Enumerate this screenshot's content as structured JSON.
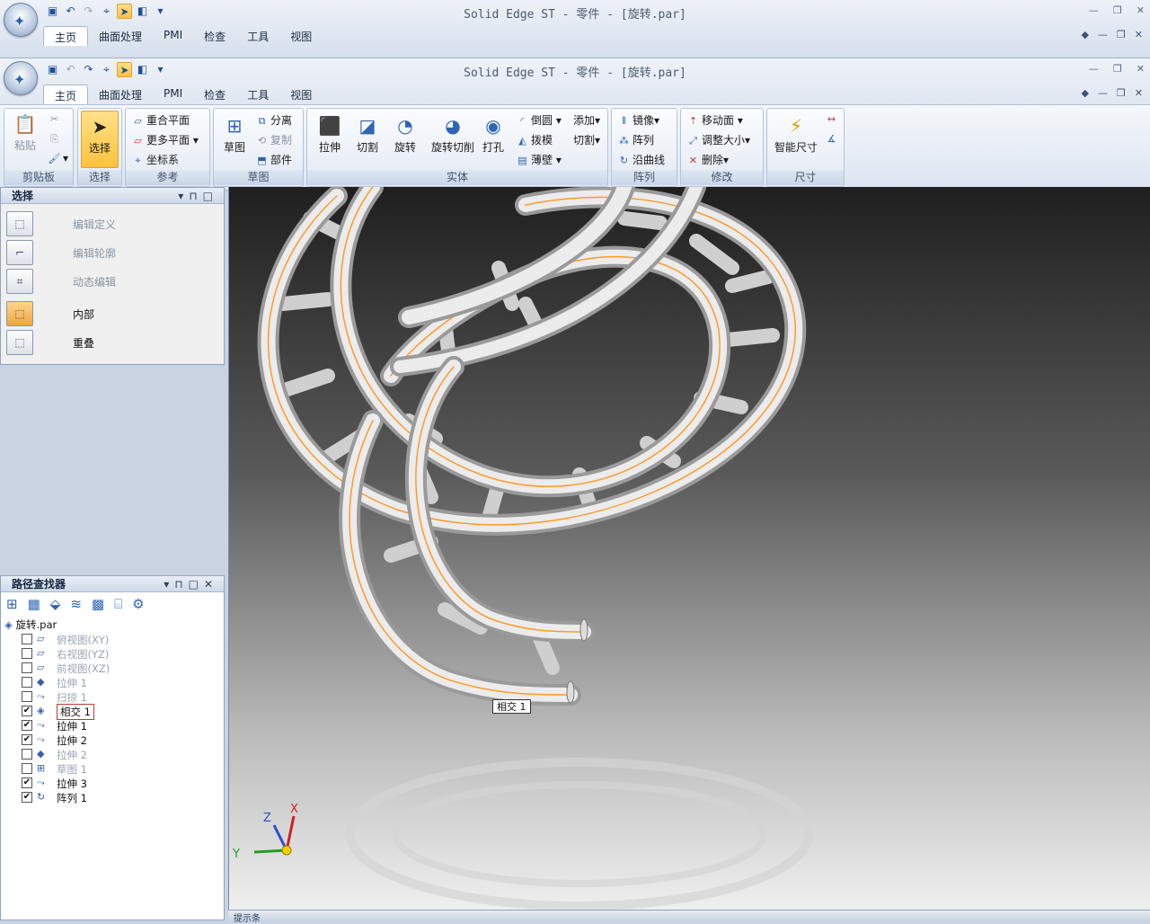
{
  "back_window": {
    "title": "Solid Edge ST - 零件 - [旋转.par]",
    "tabs": [
      "主页",
      "曲面处理",
      "PMI",
      "检查",
      "工具",
      "视图"
    ]
  },
  "window": {
    "title": "Solid Edge ST - 零件 - [旋转.par]",
    "tabs": [
      "主页",
      "曲面处理",
      "PMI",
      "检查",
      "工具",
      "视图"
    ],
    "active_tab": "主页"
  },
  "ribbon": {
    "clipboard": {
      "label": "剪贴板",
      "paste": "粘贴"
    },
    "select": {
      "label": "选择",
      "select": "选择"
    },
    "reference": {
      "label": "参考",
      "coincident_plane": "重合平面",
      "more_planes": "更多平面",
      "coordinate_system": "坐标系"
    },
    "sketch": {
      "label": "草图",
      "sketch": "草图",
      "separate": "分离",
      "copy": "复制",
      "part": "部件"
    },
    "solid": {
      "label": "实体",
      "extrude": "拉伸",
      "cut": "切割",
      "revolve": "旋转",
      "revolve_cut": "旋转切削",
      "hole": "打孔",
      "round": "倒圆",
      "draft": "拨模",
      "thin_wall": "薄壁",
      "add": "添加",
      "cut2": "切割"
    },
    "pattern": {
      "label": "阵列",
      "mirror": "镜像",
      "pattern": "阵列",
      "along_curve": "沿曲线"
    },
    "modify": {
      "label": "修改",
      "move_face": "移动面",
      "resize": "调整大小",
      "delete": "删除"
    },
    "dimension": {
      "label": "尺寸",
      "smart_dimension": "智能尺寸"
    }
  },
  "select_panel": {
    "title": "选择",
    "items": [
      {
        "label": "编辑定义",
        "enabled": false
      },
      {
        "label": "编辑轮廓",
        "enabled": false
      },
      {
        "label": "动态编辑",
        "enabled": false
      },
      {
        "label": "内部",
        "enabled": true,
        "active": true
      },
      {
        "label": "重叠",
        "enabled": true
      }
    ]
  },
  "pathfinder": {
    "title": "路径查找器",
    "root": "旋转.par",
    "items": [
      {
        "label": "俯视图(XY)",
        "checked": false,
        "enabled": false
      },
      {
        "label": "右视图(YZ)",
        "checked": false,
        "enabled": false
      },
      {
        "label": "前视图(XZ)",
        "checked": false,
        "enabled": false
      },
      {
        "label": "拉伸 1",
        "checked": false,
        "enabled": false
      },
      {
        "label": "扫掠 1",
        "checked": false,
        "enabled": false
      },
      {
        "label": "相交 1",
        "checked": true,
        "enabled": true,
        "selected": true
      },
      {
        "label": "拉伸 1",
        "checked": true,
        "enabled": true
      },
      {
        "label": "拉伸 2",
        "checked": true,
        "enabled": true
      },
      {
        "label": "拉伸 2",
        "checked": false,
        "enabled": false
      },
      {
        "label": "草图 1",
        "checked": false,
        "enabled": false
      },
      {
        "label": "拉伸 3",
        "checked": true,
        "enabled": true
      },
      {
        "label": "阵列 1",
        "checked": true,
        "enabled": true
      }
    ]
  },
  "viewport": {
    "tooltip": "相交 1",
    "axes": {
      "x": "X",
      "y": "Y",
      "z": "Z"
    }
  },
  "bottom_panel": {
    "title": "提示条"
  }
}
